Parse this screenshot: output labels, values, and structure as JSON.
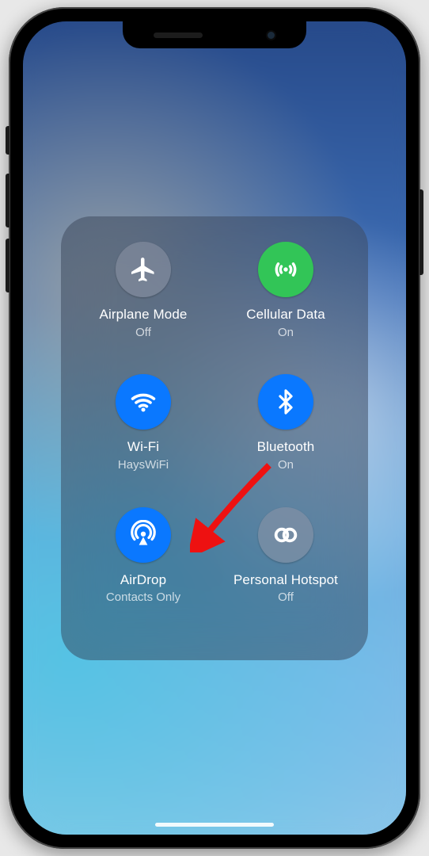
{
  "controls": {
    "airplane": {
      "label": "Airplane Mode",
      "status": "Off",
      "active": false,
      "color": "off"
    },
    "cellular": {
      "label": "Cellular Data",
      "status": "On",
      "active": true,
      "color": "green"
    },
    "wifi": {
      "label": "Wi-Fi",
      "status": "HaysWiFi",
      "active": true,
      "color": "blue"
    },
    "bluetooth": {
      "label": "Bluetooth",
      "status": "On",
      "active": true,
      "color": "blue"
    },
    "airdrop": {
      "label": "AirDrop",
      "status": "Contacts Only",
      "active": true,
      "color": "blue"
    },
    "hotspot": {
      "label": "Personal Hotspot",
      "status": "Off",
      "active": false,
      "color": "off"
    }
  },
  "annotation": {
    "kind": "arrow",
    "target": "airdrop"
  }
}
